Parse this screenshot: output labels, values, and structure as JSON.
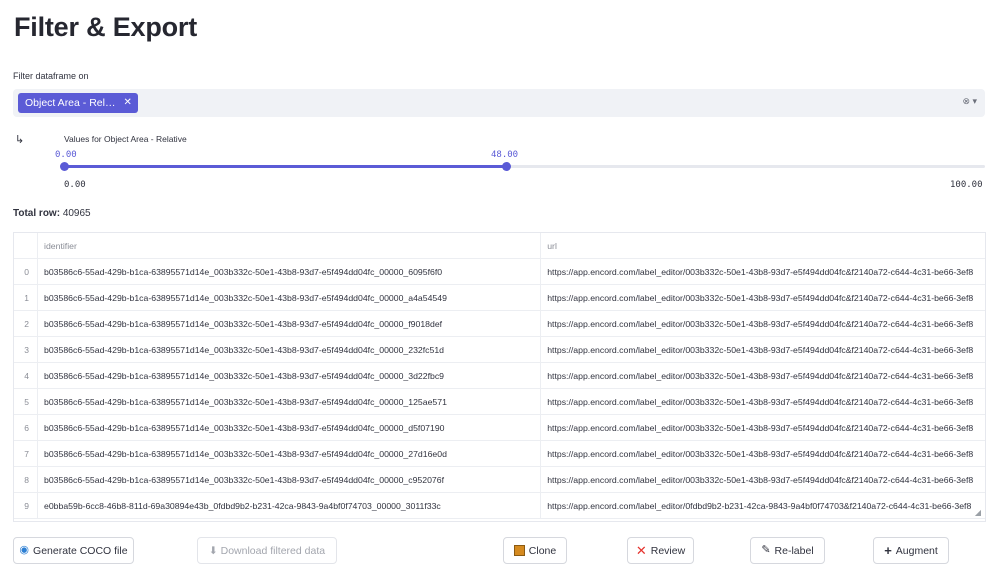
{
  "page": {
    "title": "Filter & Export"
  },
  "filter": {
    "label": "Filter dataframe on",
    "chips": [
      {
        "label": "Object Area - Rel…",
        "close": "✕"
      }
    ],
    "controls": "⊗ ▾"
  },
  "slider": {
    "arrow": "↳",
    "label": "Values for Object Area - Relative",
    "current_min": "0.00",
    "current_max": "48.00",
    "range_min": "0.00",
    "range_max": "100.00"
  },
  "summary": {
    "total_label": "Total row:",
    "total_value": "40965"
  },
  "table": {
    "columns": [
      "",
      "identifier",
      "url"
    ],
    "rows": [
      {
        "index": "0",
        "identifier": "b03586c6-55ad-429b-b1ca-63895571d14e_003b332c-50e1-43b8-93d7-e5f494dd04fc_00000_6095f6f0",
        "url": "https://app.encord.com/label_editor/003b332c-50e1-43b8-93d7-e5f494dd04fc&f2140a72-c644-4c31-be66-3ef8"
      },
      {
        "index": "1",
        "identifier": "b03586c6-55ad-429b-b1ca-63895571d14e_003b332c-50e1-43b8-93d7-e5f494dd04fc_00000_a4a54549",
        "url": "https://app.encord.com/label_editor/003b332c-50e1-43b8-93d7-e5f494dd04fc&f2140a72-c644-4c31-be66-3ef8"
      },
      {
        "index": "2",
        "identifier": "b03586c6-55ad-429b-b1ca-63895571d14e_003b332c-50e1-43b8-93d7-e5f494dd04fc_00000_f9018def",
        "url": "https://app.encord.com/label_editor/003b332c-50e1-43b8-93d7-e5f494dd04fc&f2140a72-c644-4c31-be66-3ef8"
      },
      {
        "index": "3",
        "identifier": "b03586c6-55ad-429b-b1ca-63895571d14e_003b332c-50e1-43b8-93d7-e5f494dd04fc_00000_232fc51d",
        "url": "https://app.encord.com/label_editor/003b332c-50e1-43b8-93d7-e5f494dd04fc&f2140a72-c644-4c31-be66-3ef8"
      },
      {
        "index": "4",
        "identifier": "b03586c6-55ad-429b-b1ca-63895571d14e_003b332c-50e1-43b8-93d7-e5f494dd04fc_00000_3d22fbc9",
        "url": "https://app.encord.com/label_editor/003b332c-50e1-43b8-93d7-e5f494dd04fc&f2140a72-c644-4c31-be66-3ef8"
      },
      {
        "index": "5",
        "identifier": "b03586c6-55ad-429b-b1ca-63895571d14e_003b332c-50e1-43b8-93d7-e5f494dd04fc_00000_125ae571",
        "url": "https://app.encord.com/label_editor/003b332c-50e1-43b8-93d7-e5f494dd04fc&f2140a72-c644-4c31-be66-3ef8"
      },
      {
        "index": "6",
        "identifier": "b03586c6-55ad-429b-b1ca-63895571d14e_003b332c-50e1-43b8-93d7-e5f494dd04fc_00000_d5f07190",
        "url": "https://app.encord.com/label_editor/003b332c-50e1-43b8-93d7-e5f494dd04fc&f2140a72-c644-4c31-be66-3ef8"
      },
      {
        "index": "7",
        "identifier": "b03586c6-55ad-429b-b1ca-63895571d14e_003b332c-50e1-43b8-93d7-e5f494dd04fc_00000_27d16e0d",
        "url": "https://app.encord.com/label_editor/003b332c-50e1-43b8-93d7-e5f494dd04fc&f2140a72-c644-4c31-be66-3ef8"
      },
      {
        "index": "8",
        "identifier": "b03586c6-55ad-429b-b1ca-63895571d14e_003b332c-50e1-43b8-93d7-e5f494dd04fc_00000_c952076f",
        "url": "https://app.encord.com/label_editor/003b332c-50e1-43b8-93d7-e5f494dd04fc&f2140a72-c644-4c31-be66-3ef8"
      },
      {
        "index": "9",
        "identifier": "e0bba59b-6cc8-46b8-811d-69a30894e43b_0fdbd9b2-b231-42ca-9843-9a4bf0f74703_00000_3011f33c",
        "url": "https://app.encord.com/label_editor/0fdbd9b2-b231-42ca-9843-9a4bf0f74703&f2140a72-c644-4c31-be66-3ef8"
      }
    ]
  },
  "buttons": {
    "generate_coco": {
      "label": "Generate COCO file",
      "icon": "coco-icon"
    },
    "download": {
      "label": "⬇ Download filtered data",
      "icon": "download-icon"
    },
    "clone": {
      "label": "Clone",
      "icon": "clone-icon"
    },
    "review": {
      "label": "Review",
      "icon": "x-mark-icon"
    },
    "relabel": {
      "label": "Re-label",
      "icon": "pencil-icon"
    },
    "augment": {
      "label": "Augment",
      "icon": "plus-icon"
    }
  },
  "colors": {
    "accent": "#5b5bd6",
    "review_icon": "#e5322d",
    "clone_icon": "#d58a1f"
  }
}
